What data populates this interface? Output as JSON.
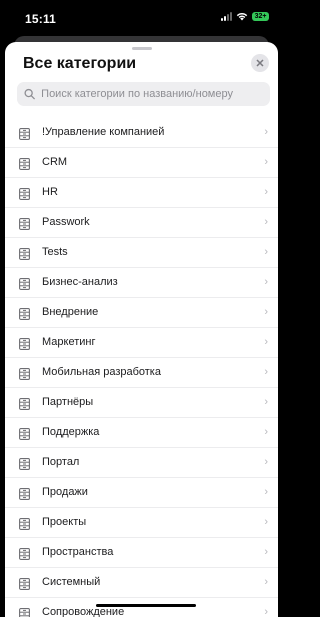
{
  "status_bar": {
    "time": "15:11",
    "battery": "32+"
  },
  "sheet": {
    "title": "Все категории",
    "close_label": "✕"
  },
  "search": {
    "placeholder": "Поиск категории по названию/номеру",
    "value": ""
  },
  "categories": [
    {
      "label": "!Управление компанией"
    },
    {
      "label": "CRM"
    },
    {
      "label": "HR"
    },
    {
      "label": "Passwork"
    },
    {
      "label": "Tests"
    },
    {
      "label": "Бизнес-анализ"
    },
    {
      "label": "Внедрение"
    },
    {
      "label": "Маркетинг"
    },
    {
      "label": "Мобильная разработка"
    },
    {
      "label": "Партнёры"
    },
    {
      "label": "Поддержка"
    },
    {
      "label": "Портал"
    },
    {
      "label": "Продажи"
    },
    {
      "label": "Проекты"
    },
    {
      "label": "Пространства"
    },
    {
      "label": "Системный"
    },
    {
      "label": "Сопровождение"
    }
  ],
  "colors": {
    "accent": "#34c759",
    "text": "#1c1c1e",
    "secondary_text": "#8e8e93"
  },
  "icons": {
    "list_item": "folder-icon",
    "row_action": "chevron-right-icon",
    "search": "search-icon",
    "close": "close-icon"
  }
}
